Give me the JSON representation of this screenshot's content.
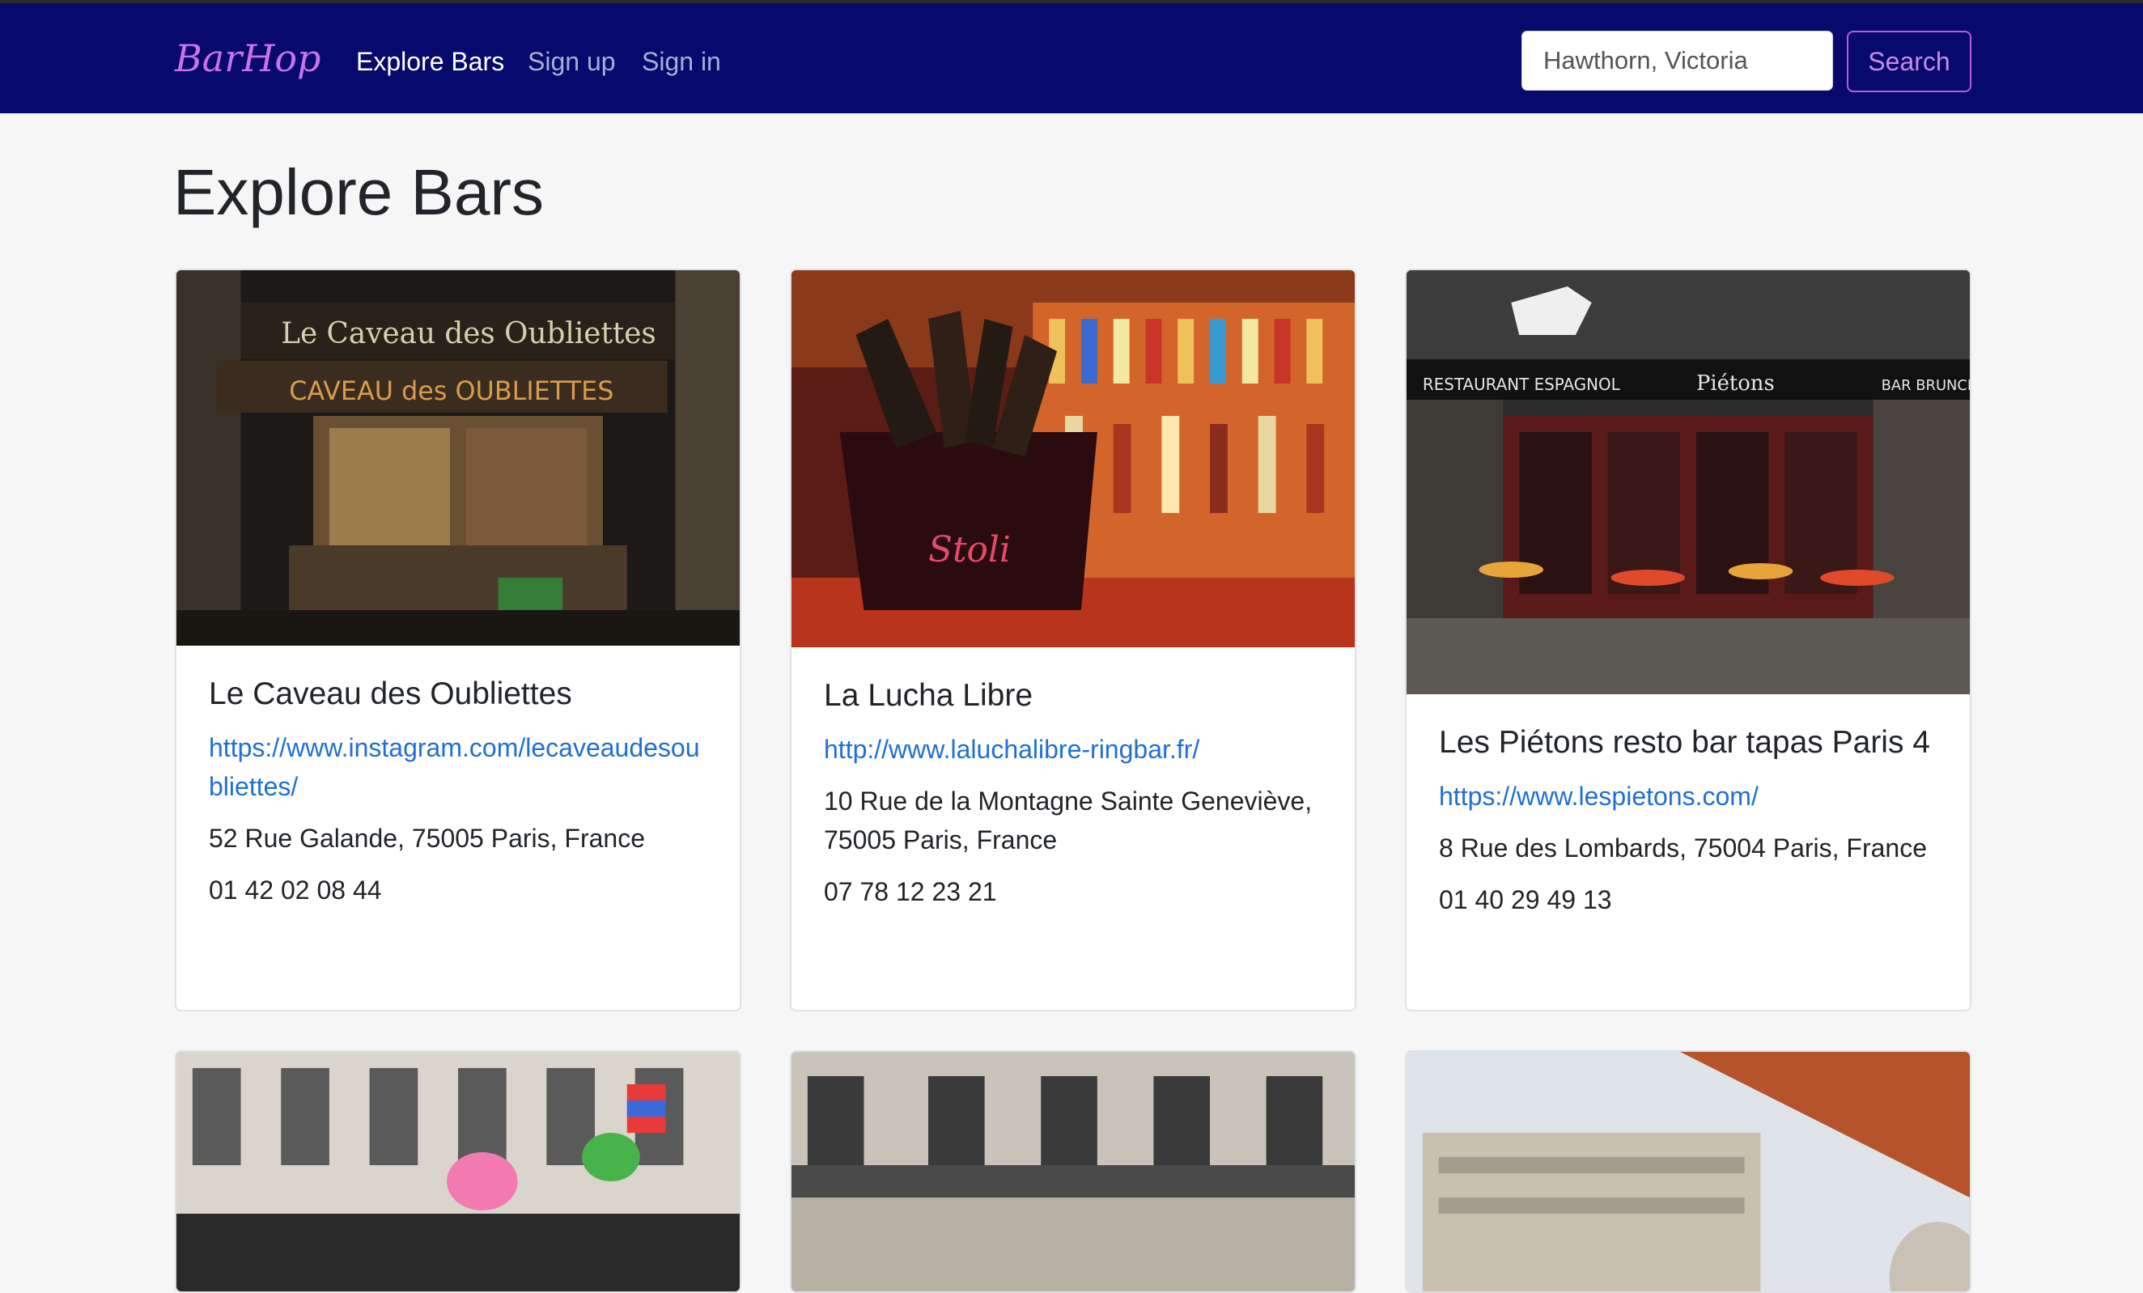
{
  "navbar": {
    "brand": "BarHop",
    "links": [
      {
        "label": "Explore Bars",
        "active": true
      },
      {
        "label": "Sign up",
        "active": false
      },
      {
        "label": "Sign in",
        "active": false
      }
    ],
    "search_value": "Hawthorn, Victoria",
    "search_button": "Search"
  },
  "colors": {
    "navbar_bg": "#08096c",
    "accent_purple": "#b45fd8",
    "link_blue": "#1f6fd6",
    "page_bg": "#f6f6f6"
  },
  "page": {
    "title": "Explore Bars"
  },
  "bars": [
    {
      "name": "Le Caveau des Oubliettes",
      "url": "https://www.instagram.com/lecaveaudesoubliettes/",
      "address": "52 Rue Galande, 75005 Paris, France",
      "phone": "01 42 02 08 44",
      "image_sign": "Le Caveau des Oubliettes",
      "image_sign2": "CAVEAU des OUBLIETTES"
    },
    {
      "name": "La Lucha Libre",
      "url": "http://www.laluchalibre-ringbar.fr/",
      "address": "10 Rue de la Montagne Sainte Geneviève, 75005 Paris, France",
      "phone": "07 78 12 23 21",
      "image_sign": "Stoli"
    },
    {
      "name": "Les Piétons resto bar tapas Paris 4",
      "url": "https://www.lespietons.com/",
      "address": "8 Rue des Lombards, 75004 Paris, France",
      "phone": "01 40 29 49 13",
      "image_sign": "RESTAURANT ESPAGNOL",
      "image_sign2": "Piétons",
      "image_sign3": "BAR BRUNCH"
    }
  ]
}
